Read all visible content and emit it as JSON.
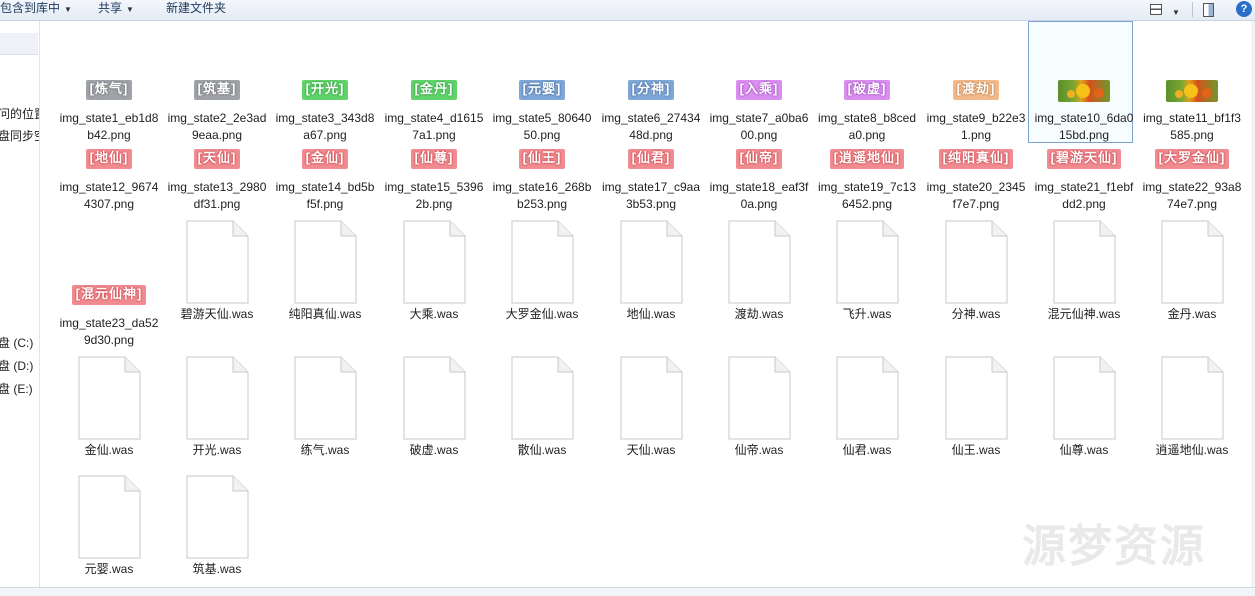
{
  "toolbar": {
    "include_library": "包含到库中",
    "share": "共享",
    "new_folder": "新建文件夹"
  },
  "nav": {
    "items": [
      "问的位置",
      "盘同步空",
      "盘 (C:)",
      "盘 (D:)",
      "盘 (E:)"
    ]
  },
  "files": [
    {
      "name": "img_state1_eb1d8b42.png",
      "badge": "[炼气]",
      "color": "gray"
    },
    {
      "name": "img_state2_2e3ad9eaa.png",
      "badge": "[筑基]",
      "color": "gray"
    },
    {
      "name": "img_state3_343d8a67.png",
      "badge": "[开光]",
      "color": "green"
    },
    {
      "name": "img_state4_d16157a1.png",
      "badge": "[金丹]",
      "color": "green"
    },
    {
      "name": "img_state5_8064050.png",
      "badge": "[元婴]",
      "color": "blue"
    },
    {
      "name": "img_state6_2743448d.png",
      "badge": "[分神]",
      "color": "blue"
    },
    {
      "name": "img_state7_a0ba600.png",
      "badge": "[入乘]",
      "color": "purple"
    },
    {
      "name": "img_state8_b8ceda0.png",
      "badge": "[破虚]",
      "color": "purple"
    },
    {
      "name": "img_state9_b22e31.png",
      "badge": "[渡劫]",
      "color": "orange"
    },
    {
      "name": "img_state10_6da015bd.png",
      "badge": "",
      "color": "flowers"
    },
    {
      "name": "img_state11_bf1f3585.png",
      "badge": "",
      "color": "flowers"
    },
    {
      "name": "img_state12_96744307.png",
      "badge": "[地仙]",
      "color": "red"
    },
    {
      "name": "img_state13_2980df31.png",
      "badge": "[天仙]",
      "color": "red"
    },
    {
      "name": "img_state14_bd5bf5f.png",
      "badge": "[金仙]",
      "color": "red"
    },
    {
      "name": "img_state15_53962b.png",
      "badge": "[仙尊]",
      "color": "red"
    },
    {
      "name": "img_state16_268bb253.png",
      "badge": "[仙王]",
      "color": "red"
    },
    {
      "name": "img_state17_c9aa3b53.png",
      "badge": "[仙君]",
      "color": "red"
    },
    {
      "name": "img_state18_eaf3f0a.png",
      "badge": "[仙帝]",
      "color": "red"
    },
    {
      "name": "img_state19_7c136452.png",
      "badge": "[逍遥地仙]",
      "color": "red"
    },
    {
      "name": "img_state20_2345f7e7.png",
      "badge": "[纯阳真仙]",
      "color": "red"
    },
    {
      "name": "img_state21_f1ebfdd2.png",
      "badge": "[碧游天仙]",
      "color": "red"
    },
    {
      "name": "img_state22_93a874e7.png",
      "badge": "[大罗金仙]",
      "color": "red"
    },
    {
      "name": "img_state23_da529d30.png",
      "badge": "[混元仙神]",
      "color": "red"
    },
    {
      "name": "碧游天仙.was",
      "badge": "",
      "color": "doc"
    },
    {
      "name": "纯阳真仙.was",
      "badge": "",
      "color": "doc"
    },
    {
      "name": "大乘.was",
      "badge": "",
      "color": "doc"
    },
    {
      "name": "大罗金仙.was",
      "badge": "",
      "color": "doc"
    },
    {
      "name": "地仙.was",
      "badge": "",
      "color": "doc"
    },
    {
      "name": "渡劫.was",
      "badge": "",
      "color": "doc"
    },
    {
      "name": "飞升.was",
      "badge": "",
      "color": "doc"
    },
    {
      "name": "分神.was",
      "badge": "",
      "color": "doc"
    },
    {
      "name": "混元仙神.was",
      "badge": "",
      "color": "doc"
    },
    {
      "name": "金丹.was",
      "badge": "",
      "color": "doc"
    },
    {
      "name": "金仙.was",
      "badge": "",
      "color": "doc"
    },
    {
      "name": "开光.was",
      "badge": "",
      "color": "doc"
    },
    {
      "name": "练气.was",
      "badge": "",
      "color": "doc"
    },
    {
      "name": "破虚.was",
      "badge": "",
      "color": "doc"
    },
    {
      "name": "散仙.was",
      "badge": "",
      "color": "doc"
    },
    {
      "name": "天仙.was",
      "badge": "",
      "color": "doc"
    },
    {
      "name": "仙帝.was",
      "badge": "",
      "color": "doc"
    },
    {
      "name": "仙君.was",
      "badge": "",
      "color": "doc"
    },
    {
      "name": "仙王.was",
      "badge": "",
      "color": "doc"
    },
    {
      "name": "仙尊.was",
      "badge": "",
      "color": "doc"
    },
    {
      "name": "逍遥地仙.was",
      "badge": "",
      "color": "doc"
    },
    {
      "name": "元婴.was",
      "badge": "",
      "color": "doc"
    },
    {
      "name": "筑基.was",
      "badge": "",
      "color": "doc"
    }
  ],
  "watermark": "源梦资源",
  "icons": {
    "view": "view-options-icon",
    "preview": "preview-pane-icon",
    "help": "help-icon",
    "file": "document-file-icon"
  },
  "colors": {
    "selection_border": "#7da2ce",
    "toolbar_text": "#1e395b"
  }
}
